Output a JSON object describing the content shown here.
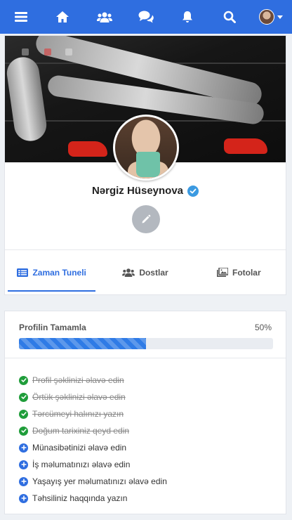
{
  "navbar": {
    "bg": "#2f6ee0",
    "icons": [
      "menu-icon",
      "home-icon",
      "friends-icon",
      "chat-icon",
      "bell-icon",
      "search-icon",
      "user-avatar"
    ]
  },
  "profile": {
    "name": "Nərgiz Hüseynova",
    "verified": true,
    "tabs": [
      {
        "label": "Zaman Tuneli",
        "icon": "timeline-icon",
        "active": true
      },
      {
        "label": "Dostlar",
        "icon": "friends-icon",
        "active": false
      },
      {
        "label": "Fotolar",
        "icon": "photos-icon",
        "active": false
      }
    ]
  },
  "completion": {
    "title": "Profilin Tamamla",
    "percent_label": "50%",
    "progress": 0.5,
    "steps": [
      {
        "label": "Profil şəklinizi əlavə edin",
        "done": true
      },
      {
        "label": "Örtük şəklinizi əlavə edin",
        "done": true
      },
      {
        "label": "Tərcümeyi halınızı yazın",
        "done": true
      },
      {
        "label": "Doğum tarixiniz qeyd edin",
        "done": true
      },
      {
        "label": "Münasibətinizi əlavə edin",
        "done": false
      },
      {
        "label": "İş məlumatınızı əlavə edin",
        "done": false
      },
      {
        "label": "Yaşayış yer məlumatınızı əlavə edin",
        "done": false
      },
      {
        "label": "Təhsiliniz haqqında yazın",
        "done": false
      }
    ]
  }
}
